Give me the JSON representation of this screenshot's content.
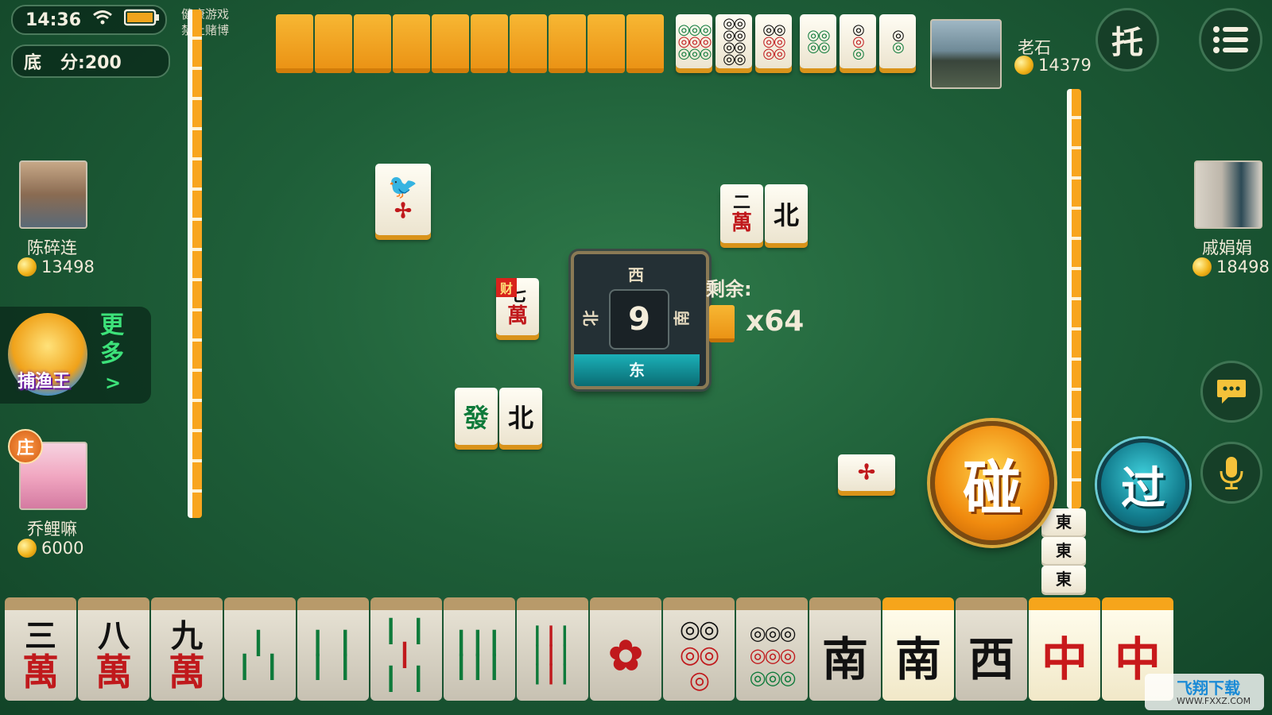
{
  "status": {
    "time": "14:36",
    "warning_line1": "健康游戏",
    "warning_line2": "禁止赌博"
  },
  "base_score": {
    "label": "底",
    "label2": "分:",
    "value": "200"
  },
  "players": {
    "top": {
      "name": "老石",
      "coins": "14379"
    },
    "left": {
      "name": "陈碎连",
      "coins": "13498"
    },
    "right": {
      "name": "戚娟娟",
      "coins": "18498"
    },
    "self": {
      "name": "乔鲤嘛",
      "coins": "6000",
      "dealer_badge": "庄"
    }
  },
  "compass": {
    "number": "9",
    "north": "北",
    "south": "南",
    "west": "西",
    "east": "东"
  },
  "remaining": {
    "label": "剩余:",
    "count": "x64"
  },
  "discards": {
    "left_player": [
      "幺鸡"
    ],
    "top_player": [
      "二萬",
      "北"
    ],
    "center": {
      "caishen_badge": "财",
      "tile_top": "七",
      "tile_bottom": "萬"
    },
    "self": [
      "發",
      "北"
    ],
    "right_player": [
      "一条"
    ]
  },
  "right_melds": [
    "東",
    "東",
    "東"
  ],
  "hand": [
    {
      "top": "三",
      "bottom": "萬",
      "kind": "wan"
    },
    {
      "top": "八",
      "bottom": "萬",
      "kind": "wan"
    },
    {
      "top": "九",
      "bottom": "萬",
      "kind": "wan"
    },
    {
      "symbol": "2 bamboo",
      "kind": "bam"
    },
    {
      "symbol": "4 bamboo",
      "kind": "bam"
    },
    {
      "symbol": "5 bamboo",
      "kind": "bam"
    },
    {
      "symbol": "6 bamboo",
      "kind": "bam"
    },
    {
      "symbol": "9 bamboo",
      "kind": "bam"
    },
    {
      "symbol": "1 dot",
      "kind": "dot"
    },
    {
      "symbol": "4 dots",
      "kind": "dot"
    },
    {
      "symbol": "9 dots",
      "kind": "dot"
    },
    {
      "char": "南",
      "kind": "wind"
    },
    {
      "char": "南",
      "kind": "wind",
      "selected": true
    },
    {
      "char": "西",
      "kind": "wind"
    },
    {
      "char": "中",
      "kind": "dragon",
      "selected": true
    },
    {
      "char": "中",
      "kind": "dragon",
      "selected": true
    }
  ],
  "actions": {
    "pong": "碰",
    "pass": "过",
    "auto": "托"
  },
  "promo": {
    "more_1": "更",
    "more_2": "多",
    "arrow": ">",
    "game_name": "捕渔王"
  },
  "watermark": {
    "site": "飞翔下载",
    "url": "WWW.FXXZ.COM"
  },
  "colors": {
    "felt": "#1e5e38",
    "wall": "#f8a51e",
    "wan_red": "#c0191c",
    "bamboo_green": "#0e7a3a"
  },
  "icons": [
    "wifi-icon",
    "battery-icon",
    "menu-icon",
    "chat-icon",
    "microphone-icon",
    "coin-icon"
  ]
}
